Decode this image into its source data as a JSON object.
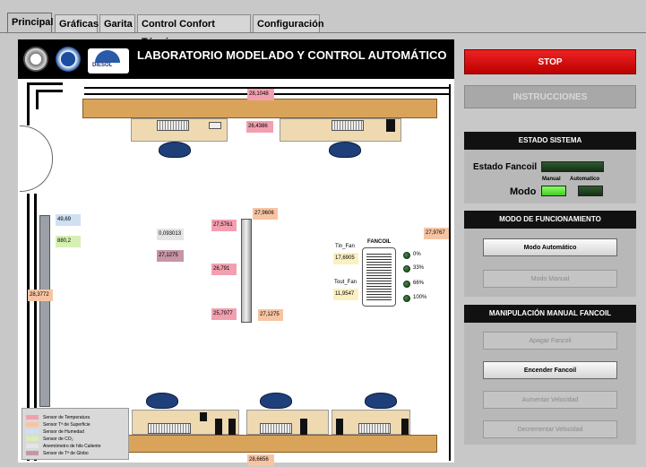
{
  "tabs": [
    {
      "label": "Principal",
      "active": true
    },
    {
      "label": "Gráficas",
      "active": false
    },
    {
      "label": "Garita",
      "active": false
    },
    {
      "label": "Control Confort Térmico",
      "active": false
    },
    {
      "label": "Configuración",
      "active": false
    }
  ],
  "plan": {
    "title": "LABORATORIO MODELADO Y CONTROL AUTOMÁTICO",
    "logo_text": "DIESOL"
  },
  "sensors": {
    "top_wall": "28,1048",
    "desk_top": "26,4386",
    "left_hum": "49,69",
    "left_co2": "880,2",
    "left_wall": "28,3772",
    "island": "0,093013",
    "globe": "27,1275",
    "col_temp_1": "27,5761",
    "col_surf_1": "27,9606",
    "col_temp_2": "26,791",
    "col_temp_3": "25,7977",
    "col_surf_2": "27,1275",
    "right_surf": "27,9767",
    "bottom": "28,6656"
  },
  "fancoil": {
    "title": "FANCOIL",
    "tin_label": "Tin_Fan",
    "tin_value": "17,6905",
    "tout_label": "Tout_Fan",
    "tout_value": "11,9547",
    "speeds": [
      "0%",
      "33%",
      "66%",
      "100%"
    ]
  },
  "legend": [
    {
      "label": "Sensor de Temperatura",
      "color": "#f2a0b0"
    },
    {
      "label": "Sensor Tª de Superficie",
      "color": "#f7c4a3"
    },
    {
      "label": "Sensor de Humedad",
      "color": "#cfe0f2"
    },
    {
      "label": "Sensor de CO₂",
      "color": "#d6f0b3"
    },
    {
      "label": "Anemómetro de hilo Caliente",
      "color": "#e4e4e4"
    },
    {
      "label": "Sensor de Tª de Globo",
      "color": "#c795a5"
    }
  ],
  "controls": {
    "stop_label": "STOP",
    "instructions_label": "INSTRUCCIONES",
    "estado_sistema_title": "ESTADO SISTEMA",
    "estado_fancoil_label": "Estado Fancoil",
    "modo_label": "Modo",
    "manual_label": "Manual",
    "automatico_label": "Automatico",
    "modo_func_title": "MODO DE FUNCIONAMIENTO",
    "modo_auto_btn": "Modo Automático",
    "modo_manual_btn": "Modo Manual",
    "manip_title": "MANIPULACIÓN MANUAL FANCOIL",
    "apagar_btn": "Apagar Fancoil",
    "encender_btn": "Encender Fancoil",
    "aumentar_btn": "Aumentar Velocidad",
    "decrementar_btn": "Decrementar Velocidad"
  },
  "colors": {
    "stop_red": "#cc1111",
    "led_green_on": "#66ee44",
    "led_green_off": "#1f4a1f"
  }
}
